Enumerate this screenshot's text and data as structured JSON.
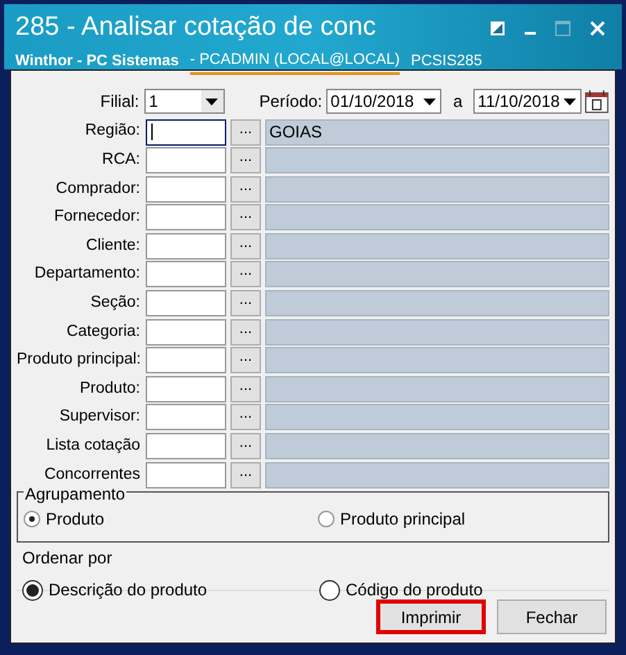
{
  "window": {
    "title": "285 - Analisar cotação de conc",
    "app": "Winthor - PC Sistemas",
    "user": "- PCADMIN (LOCAL@LOCAL)",
    "routine": "PCSIS285"
  },
  "filial": {
    "label": "Filial:",
    "value": "1"
  },
  "periodo": {
    "label": "Período:",
    "from": "01/10/2018",
    "separator": "a",
    "to": "11/10/2018"
  },
  "fields": [
    {
      "label": "Região:",
      "description": "GOIAS",
      "focused": true,
      "button": "..."
    },
    {
      "label": "RCA:",
      "focused": false,
      "button": "..."
    },
    {
      "label": "Comprador:",
      "focused": false,
      "button": "..."
    },
    {
      "label": "Fornecedor:",
      "focused": false,
      "button": "..."
    },
    {
      "label": "Cliente:",
      "focused": false,
      "button": "..."
    },
    {
      "label": "Departamento:",
      "focused": false,
      "button": "..."
    },
    {
      "label": "Seção:",
      "focused": false,
      "button": "..."
    },
    {
      "label": "Categoria:",
      "focused": false,
      "button": "..."
    },
    {
      "label": "Produto principal:",
      "focused": false,
      "button": "..."
    },
    {
      "label": "Produto:",
      "focused": false,
      "button": "..."
    },
    {
      "label": "Supervisor:",
      "focused": false,
      "button": "..."
    },
    {
      "label": "Lista cotação",
      "focused": false,
      "button": "..."
    },
    {
      "label": "Concorrentes",
      "focused": false,
      "button": "..."
    }
  ],
  "agrupamento": {
    "title": "Agrupamento",
    "options": [
      {
        "label": "Produto",
        "selected": true
      },
      {
        "label": "Produto principal",
        "selected": false
      }
    ]
  },
  "ordenar": {
    "title": "Ordenar por",
    "options": [
      {
        "label": "Descrição do produto",
        "selected": true
      },
      {
        "label": "Código do produto",
        "selected": false
      }
    ]
  },
  "buttons": [
    {
      "label": "Imprimir",
      "highlighted": true
    },
    {
      "label": "Fechar",
      "highlighted": false
    }
  ]
}
